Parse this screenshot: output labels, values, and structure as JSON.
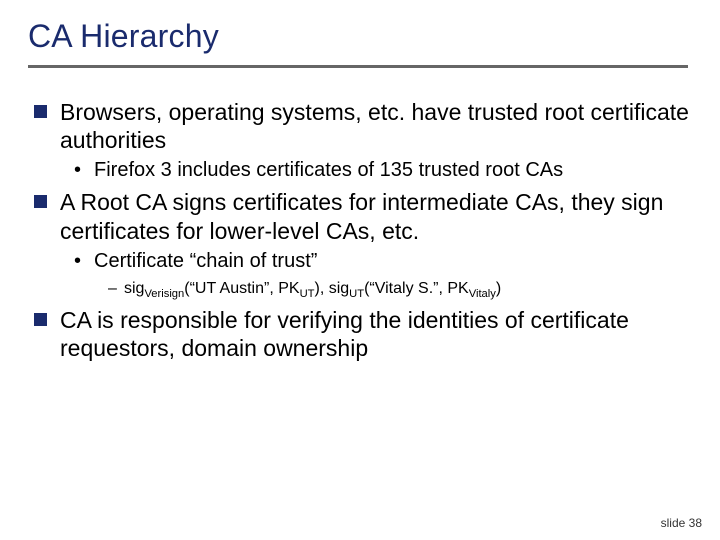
{
  "title": "CA Hierarchy",
  "footer": "slide 38",
  "b1": "Browsers, operating systems, etc. have trusted root certificate authorities",
  "b1a": "Firefox 3 includes certificates of 135 trusted root CAs",
  "b2": "A Root CA signs certificates for intermediate CAs, they sign certificates for lower-level CAs, etc.",
  "b2a": "Certificate “chain of trust”",
  "b2a1_pre": "sig",
  "b2a1_sub1": "Verisign",
  "b2a1_mid1": "(“UT Austin”, PK",
  "b2a1_sub2": "UT",
  "b2a1_mid2": "), sig",
  "b2a1_sub3": "UT",
  "b2a1_mid3": "(“Vitaly S.”, PK",
  "b2a1_sub4": "Vitaly",
  "b2a1_end": ")",
  "b3": "CA is responsible for verifying the identities of certificate requestors, domain ownership"
}
